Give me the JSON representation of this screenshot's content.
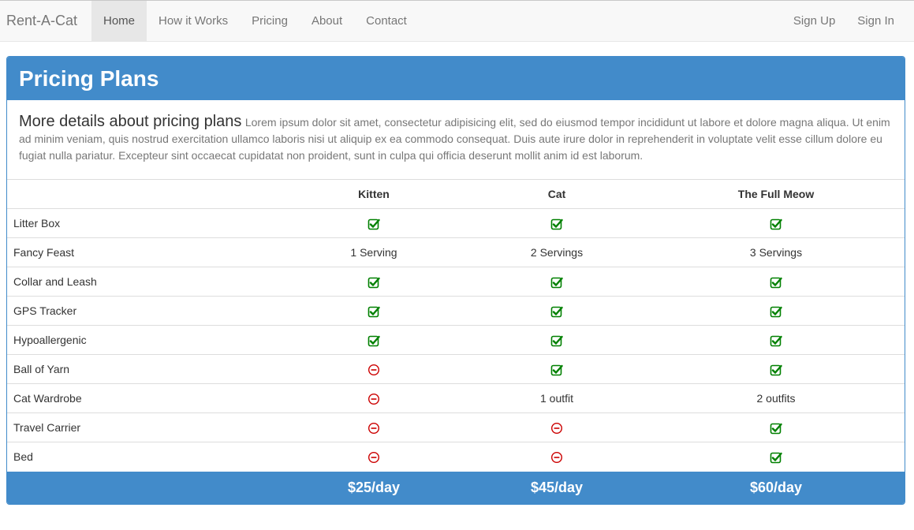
{
  "navbar": {
    "brand": "Rent-A-Cat",
    "left_items": [
      "Home",
      "How it Works",
      "Pricing",
      "About",
      "Contact"
    ],
    "active_item": "Home",
    "right_items": [
      "Sign Up",
      "Sign In"
    ]
  },
  "panel": {
    "title": "Pricing Plans",
    "lead": "More details about pricing plans",
    "description": "Lorem ipsum dolor sit amet, consectetur adipisicing elit, sed do eiusmod tempor incididunt ut labore et dolore magna aliqua. Ut enim ad minim veniam, quis nostrud exercitation ullamco laboris nisi ut aliquip ex ea commodo consequat. Duis aute irure dolor in reprehenderit in voluptate velit esse cillum dolore eu fugiat nulla pariatur. Excepteur sint occaecat cupidatat non proident, sunt in culpa qui officia deserunt mollit anim id est laborum."
  },
  "table": {
    "plans": [
      "Kitten",
      "Cat",
      "The Full Meow"
    ],
    "rows": [
      {
        "feature": "Litter Box",
        "values": [
          "check-icon",
          "check-icon",
          "check-icon"
        ]
      },
      {
        "feature": "Fancy Feast",
        "values": [
          "1 Serving",
          "2 Servings",
          "3 Servings"
        ]
      },
      {
        "feature": "Collar and Leash",
        "values": [
          "check-icon",
          "check-icon",
          "check-icon"
        ]
      },
      {
        "feature": "GPS Tracker",
        "values": [
          "check-icon",
          "check-icon",
          "check-icon"
        ]
      },
      {
        "feature": "Hypoallergenic",
        "values": [
          "check-icon",
          "check-icon",
          "check-icon"
        ]
      },
      {
        "feature": "Ball of Yarn",
        "values": [
          "minus-icon",
          "check-icon",
          "check-icon"
        ]
      },
      {
        "feature": "Cat Wardrobe",
        "values": [
          "minus-icon",
          "1 outfit",
          "2 outfits"
        ]
      },
      {
        "feature": "Travel Carrier",
        "values": [
          "minus-icon",
          "minus-icon",
          "check-icon"
        ]
      },
      {
        "feature": "Bed",
        "values": [
          "minus-icon",
          "minus-icon",
          "check-icon"
        ]
      }
    ],
    "prices": [
      "$25/day",
      "$45/day",
      "$60/day"
    ]
  },
  "colors": {
    "primary": "#428bca",
    "check": "#008000",
    "minus": "#cc0000",
    "navbar_bg": "#f8f8f8"
  }
}
